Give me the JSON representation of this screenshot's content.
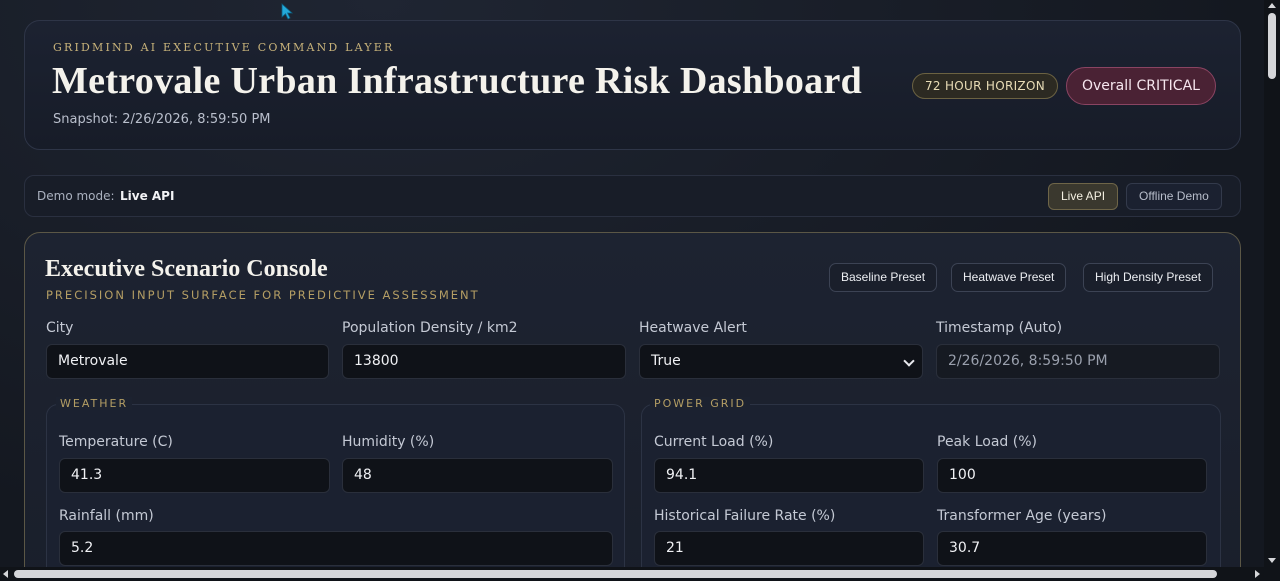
{
  "header": {
    "kicker": "GRIDMIND AI EXECUTIVE COMMAND LAYER",
    "title": "Metrovale Urban Infrastructure Risk Dashboard",
    "snapshot": "Snapshot: 2/26/2026, 8:59:50 PM",
    "horizon_badge": "72 HOUR HORIZON",
    "overall_badge": "Overall CRITICAL"
  },
  "demo": {
    "label": "Demo mode:",
    "value": "Live API",
    "options": [
      "Live API",
      "Offline Demo"
    ],
    "selected": "Live API"
  },
  "console": {
    "title": "Executive Scenario Console",
    "subtitle": "PRECISION INPUT SURFACE FOR PREDICTIVE ASSESSMENT",
    "presets": [
      "Baseline Preset",
      "Heatwave Preset",
      "High Density Preset"
    ],
    "fields": {
      "city": {
        "label": "City",
        "value": "Metrovale"
      },
      "population_density": {
        "label": "Population Density / km2",
        "value": "13800"
      },
      "heatwave_alert": {
        "label": "Heatwave Alert",
        "value": "True"
      },
      "timestamp": {
        "label": "Timestamp (Auto)",
        "value": "2/26/2026, 8:59:50 PM"
      }
    },
    "weather": {
      "legend": "WEATHER",
      "temperature": {
        "label": "Temperature (C)",
        "value": "41.3"
      },
      "humidity": {
        "label": "Humidity (%)",
        "value": "48"
      },
      "rainfall": {
        "label": "Rainfall (mm)",
        "value": "5.2"
      }
    },
    "power_grid": {
      "legend": "POWER GRID",
      "current_load": {
        "label": "Current Load (%)",
        "value": "94.1"
      },
      "peak_load": {
        "label": "Peak Load (%)",
        "value": "100"
      },
      "failure_rate": {
        "label": "Historical Failure Rate (%)",
        "value": "21"
      },
      "transformer_age": {
        "label": "Transformer Age (years)",
        "value": "30.7"
      }
    }
  }
}
